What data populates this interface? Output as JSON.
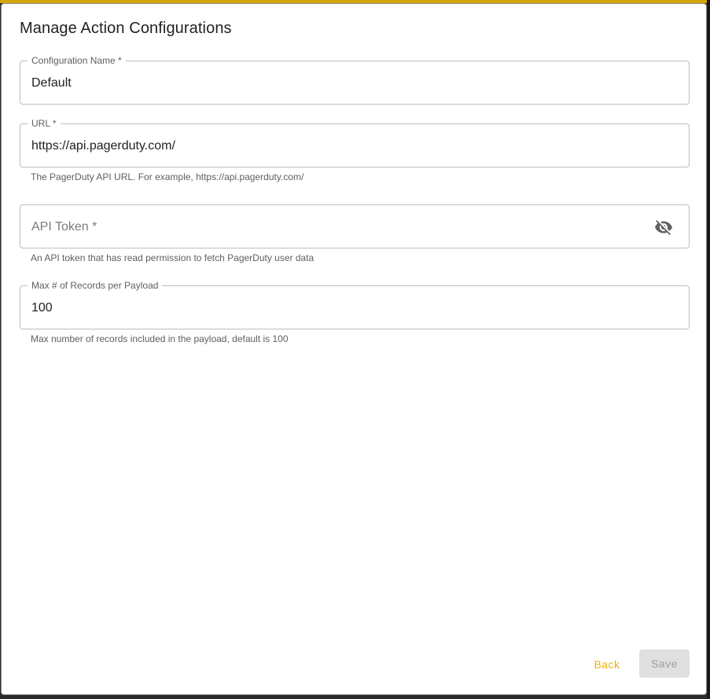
{
  "dialog": {
    "title": "Manage Action Configurations"
  },
  "fields": {
    "config_name": {
      "label": "Configuration Name *",
      "value": "Default"
    },
    "url": {
      "label": "URL *",
      "value": "https://api.pagerduty.com/",
      "helper": "The PagerDuty API URL. For example, https://api.pagerduty.com/"
    },
    "api_token": {
      "label": "API Token *",
      "value": "",
      "helper": "An API token that has read permission to fetch PagerDuty user data",
      "icon": "visibility-off-icon"
    },
    "max_records": {
      "label": "Max # of Records per Payload",
      "value": "100",
      "helper": "Max number of records included in the payload, default is 100"
    }
  },
  "actions": {
    "back_label": "Back",
    "save_label": "Save"
  },
  "colors": {
    "accent": "#e8b01a",
    "disabled_bg": "#e0e0e0",
    "disabled_text": "#9e9e9e"
  }
}
